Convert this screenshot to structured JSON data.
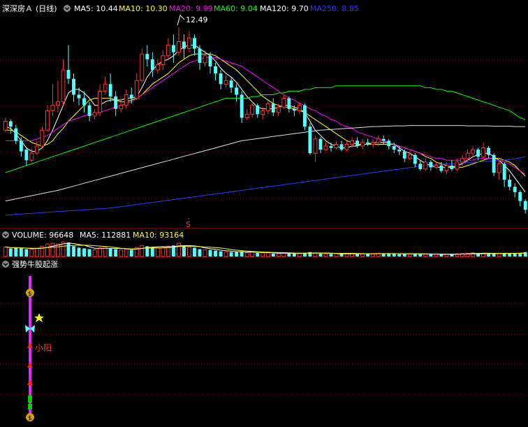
{
  "main_panel": {
    "stock_name": "深深房Ａ",
    "period": "(日线)",
    "ma_values": [
      {
        "label": "MA5: 10.44",
        "color": "#ffffff"
      },
      {
        "label": "MA10: 10.30",
        "color": "#ffff00"
      },
      {
        "label": "MA20: 9.99",
        "color": "#ff00ff"
      },
      {
        "label": "MA60: 9.04",
        "color": "#00ff00"
      },
      {
        "label": "MA120: 9.70",
        "color": "#ffffff"
      },
      {
        "label": "MA250: 8.85",
        "color": "#3333ff"
      }
    ],
    "high_label": "12.49",
    "marker_label": "S"
  },
  "volume_panel": {
    "title": "VOLUME: 96648",
    "ma5": "MA5: 112881",
    "ma10": "MA10: 93164"
  },
  "indicator_panel": {
    "title": "强势牛股起涨",
    "annotation": "小阳"
  },
  "colors": {
    "up": "#ff3232",
    "down": "#54ffff",
    "grid": "#8a0000",
    "separator": "#aa0000"
  },
  "chart_data": {
    "type": "candlestick",
    "y_range": [
      7.0,
      12.8
    ],
    "highest_price": 12.49,
    "candles": [
      [
        9.6,
        9.85,
        9.95,
        9.55
      ],
      [
        9.85,
        9.7,
        9.9,
        9.5
      ],
      [
        9.65,
        9.3,
        9.75,
        9.2
      ],
      [
        9.3,
        9.0,
        9.4,
        8.85
      ],
      [
        9.05,
        8.75,
        9.1,
        8.6
      ],
      [
        8.75,
        8.95,
        9.1,
        8.7
      ],
      [
        8.95,
        9.15,
        9.3,
        8.9
      ],
      [
        9.15,
        9.6,
        9.7,
        9.1
      ],
      [
        9.6,
        10.15,
        10.3,
        9.55
      ],
      [
        10.15,
        10.3,
        10.9,
        10.0
      ],
      [
        10.3,
        10.4,
        11.0,
        10.1
      ],
      [
        10.4,
        11.3,
        11.6,
        10.3
      ],
      [
        11.3,
        11.05,
        12.0,
        10.9
      ],
      [
        11.05,
        10.6,
        11.2,
        10.4
      ],
      [
        10.6,
        10.5,
        10.8,
        10.3
      ],
      [
        10.5,
        10.3,
        10.7,
        10.1
      ],
      [
        10.3,
        10.0,
        10.4,
        9.85
      ],
      [
        10.0,
        10.1,
        10.2,
        9.9
      ],
      [
        10.1,
        10.7,
        10.9,
        10.0
      ],
      [
        10.7,
        10.9,
        11.1,
        10.6
      ],
      [
        10.9,
        10.55,
        11.2,
        10.4
      ],
      [
        10.55,
        10.2,
        10.7,
        10.0
      ],
      [
        10.2,
        10.3,
        10.5,
        10.1
      ],
      [
        10.3,
        10.6,
        10.75,
        10.2
      ],
      [
        10.6,
        10.5,
        10.8,
        10.35
      ],
      [
        10.5,
        11.0,
        11.2,
        10.45
      ],
      [
        11.0,
        11.75,
        11.9,
        10.95
      ],
      [
        11.75,
        11.6,
        12.0,
        11.4
      ],
      [
        11.6,
        11.3,
        11.8,
        11.1
      ],
      [
        11.3,
        11.45,
        11.6,
        11.2
      ],
      [
        11.45,
        11.7,
        11.85,
        11.3
      ],
      [
        11.7,
        12.0,
        12.2,
        11.6
      ],
      [
        12.0,
        11.8,
        12.3,
        11.5
      ],
      [
        11.8,
        12.1,
        12.49,
        11.7
      ],
      [
        12.1,
        11.9,
        12.3,
        11.6
      ],
      [
        11.9,
        12.2,
        12.4,
        11.8
      ],
      [
        12.2,
        11.9,
        12.3,
        11.7
      ],
      [
        11.9,
        11.5,
        12.0,
        11.3
      ],
      [
        11.5,
        11.7,
        11.85,
        11.4
      ],
      [
        11.7,
        11.4,
        11.8,
        11.2
      ],
      [
        11.4,
        11.2,
        11.5,
        11.0
      ],
      [
        11.2,
        10.9,
        11.3,
        10.75
      ],
      [
        10.9,
        11.0,
        11.15,
        10.8
      ],
      [
        11.0,
        10.8,
        11.1,
        10.65
      ],
      [
        10.8,
        10.6,
        10.9,
        10.4
      ],
      [
        10.6,
        9.95,
        10.7,
        9.8
      ],
      [
        9.95,
        10.05,
        10.2,
        9.9
      ],
      [
        10.05,
        10.3,
        10.4,
        9.95
      ],
      [
        10.3,
        10.05,
        10.35,
        9.95
      ],
      [
        10.05,
        10.15,
        10.25,
        9.9
      ],
      [
        10.15,
        10.35,
        10.45,
        10.05
      ],
      [
        10.35,
        10.1,
        10.5,
        10.0
      ],
      [
        10.1,
        10.25,
        10.35,
        10.0
      ],
      [
        10.25,
        10.5,
        10.6,
        10.2
      ],
      [
        10.5,
        10.2,
        10.55,
        10.1
      ],
      [
        10.2,
        10.15,
        10.3,
        10.0
      ],
      [
        10.15,
        10.3,
        10.4,
        10.05
      ],
      [
        10.3,
        9.7,
        10.35,
        9.6
      ],
      [
        9.7,
        8.95,
        9.8,
        8.9
      ],
      [
        8.95,
        9.35,
        9.45,
        8.7
      ],
      [
        9.35,
        9.05,
        9.4,
        8.95
      ],
      [
        9.05,
        9.15,
        9.25,
        9.0
      ],
      [
        9.15,
        9.1,
        9.25,
        9.0
      ],
      [
        9.1,
        9.2,
        9.3,
        9.05
      ],
      [
        9.2,
        9.05,
        9.3,
        9.0
      ],
      [
        9.05,
        9.2,
        9.3,
        9.0
      ],
      [
        9.2,
        9.3,
        9.4,
        9.1
      ],
      [
        9.3,
        9.15,
        9.4,
        9.1
      ],
      [
        9.15,
        9.25,
        9.35,
        9.05
      ],
      [
        9.25,
        9.2,
        9.35,
        9.15
      ],
      [
        9.2,
        9.25,
        9.35,
        9.1
      ],
      [
        9.25,
        9.35,
        9.45,
        9.15
      ],
      [
        9.35,
        9.3,
        9.45,
        9.2
      ],
      [
        9.3,
        9.15,
        9.35,
        9.05
      ],
      [
        9.15,
        9.05,
        9.25,
        8.95
      ],
      [
        9.05,
        9.0,
        9.15,
        8.9
      ],
      [
        9.0,
        8.8,
        9.05,
        8.7
      ],
      [
        8.8,
        8.9,
        9.0,
        8.75
      ],
      [
        8.9,
        8.65,
        8.95,
        8.55
      ],
      [
        8.65,
        8.5,
        8.75,
        8.45
      ],
      [
        8.5,
        8.7,
        8.8,
        8.45
      ],
      [
        8.7,
        8.55,
        8.75,
        8.45
      ],
      [
        8.55,
        8.6,
        8.7,
        8.5
      ],
      [
        8.6,
        8.45,
        8.7,
        8.4
      ],
      [
        8.45,
        8.6,
        8.7,
        8.35
      ],
      [
        8.6,
        8.5,
        8.75,
        8.45
      ],
      [
        8.5,
        8.7,
        8.8,
        8.45
      ],
      [
        8.7,
        8.8,
        8.9,
        8.6
      ],
      [
        8.8,
        8.95,
        9.05,
        8.7
      ],
      [
        8.95,
        9.05,
        9.15,
        8.85
      ],
      [
        9.05,
        8.85,
        9.1,
        8.75
      ],
      [
        8.85,
        9.1,
        9.25,
        8.8
      ],
      [
        9.1,
        8.9,
        9.15,
        8.8
      ],
      [
        8.9,
        8.4,
        8.95,
        8.3
      ],
      [
        8.4,
        8.65,
        8.75,
        8.2
      ],
      [
        8.65,
        8.2,
        8.7,
        8.0
      ],
      [
        8.2,
        8.0,
        8.35,
        7.9
      ],
      [
        8.0,
        7.85,
        8.1,
        7.7
      ],
      [
        7.85,
        7.6,
        7.9,
        7.45
      ],
      [
        7.6,
        7.35,
        7.65,
        7.25
      ]
    ],
    "ma_series": [
      {
        "name": "MA5",
        "color": "#ffffff",
        "values": [
          9.7,
          9.65,
          9.5,
          9.3,
          9.1,
          9.0,
          9.0,
          9.1,
          9.3,
          9.6,
          9.95,
          10.3,
          10.65,
          10.75,
          10.75,
          10.65,
          10.5,
          10.3,
          10.3,
          10.4,
          10.45,
          10.45,
          10.45,
          10.5,
          10.5,
          10.55,
          10.8,
          11.1,
          11.3,
          11.45,
          11.55,
          11.6,
          11.7,
          11.85,
          11.95,
          12.0,
          12.0,
          11.9,
          11.8,
          11.7,
          11.55,
          11.35,
          11.2,
          11.1,
          10.95,
          10.75,
          10.55,
          10.4,
          10.25,
          10.2,
          10.2,
          10.2,
          10.25,
          10.3,
          10.3,
          10.25,
          10.2,
          10.1,
          9.85,
          9.6,
          9.45,
          9.3,
          9.2,
          9.15,
          9.1,
          9.1,
          9.15,
          9.15,
          9.2,
          9.2,
          9.25,
          9.25,
          9.25,
          9.25,
          9.2,
          9.1,
          9.0,
          8.95,
          8.85,
          8.75,
          8.65,
          8.6,
          8.55,
          8.55,
          8.55,
          8.55,
          8.6,
          8.65,
          8.75,
          8.85,
          8.9,
          8.95,
          8.95,
          8.85,
          8.75,
          8.6,
          8.45,
          8.25,
          8.05,
          7.85
        ]
      },
      {
        "name": "MA10",
        "color": "#ffff00",
        "values": [
          9.6,
          9.6,
          9.55,
          9.45,
          9.35,
          9.25,
          9.2,
          9.15,
          9.2,
          9.3,
          9.5,
          9.65,
          9.85,
          10.0,
          10.15,
          10.3,
          10.45,
          10.5,
          10.5,
          10.5,
          10.5,
          10.45,
          10.4,
          10.4,
          10.45,
          10.5,
          10.6,
          10.75,
          10.9,
          11.0,
          11.1,
          11.2,
          11.35,
          11.5,
          11.6,
          11.7,
          11.75,
          11.75,
          11.75,
          11.75,
          11.7,
          11.6,
          11.5,
          11.4,
          11.3,
          11.15,
          11.0,
          10.85,
          10.7,
          10.55,
          10.45,
          10.35,
          10.3,
          10.25,
          10.25,
          10.2,
          10.15,
          10.1,
          10.0,
          9.9,
          9.8,
          9.7,
          9.6,
          9.5,
          9.4,
          9.3,
          9.25,
          9.2,
          9.2,
          9.2,
          9.2,
          9.2,
          9.2,
          9.2,
          9.2,
          9.15,
          9.1,
          9.05,
          9.0,
          8.95,
          8.85,
          8.8,
          8.7,
          8.65,
          8.6,
          8.55,
          8.55,
          8.55,
          8.6,
          8.65,
          8.7,
          8.75,
          8.8,
          8.8,
          8.8,
          8.75,
          8.7,
          8.6,
          8.45,
          8.3
        ]
      },
      {
        "name": "MA20",
        "color": "#ff00ff",
        "values": [
          9.3,
          9.3,
          9.3,
          9.3,
          9.3,
          9.3,
          9.35,
          9.4,
          9.45,
          9.55,
          9.65,
          9.75,
          9.85,
          9.9,
          9.95,
          10.0,
          10.05,
          10.05,
          10.1,
          10.15,
          10.2,
          10.25,
          10.3,
          10.35,
          10.4,
          10.5,
          10.6,
          10.7,
          10.8,
          10.9,
          11.0,
          11.1,
          11.2,
          11.3,
          11.4,
          11.5,
          11.55,
          11.6,
          11.65,
          11.65,
          11.65,
          11.6,
          11.55,
          11.5,
          11.45,
          11.4,
          11.3,
          11.2,
          11.1,
          11.0,
          10.9,
          10.8,
          10.7,
          10.6,
          10.5,
          10.45,
          10.35,
          10.3,
          10.2,
          10.15,
          10.05,
          10.0,
          9.9,
          9.85,
          9.75,
          9.7,
          9.65,
          9.55,
          9.5,
          9.45,
          9.4,
          9.35,
          9.3,
          9.25,
          9.2,
          9.15,
          9.1,
          9.05,
          9.0,
          8.95,
          8.9,
          8.85,
          8.8,
          8.8,
          8.75,
          8.75,
          8.75,
          8.75,
          8.75,
          8.75,
          8.8,
          8.8,
          8.8,
          8.8,
          8.75,
          8.7,
          8.65,
          8.55,
          8.45,
          8.35
        ]
      },
      {
        "name": "MA60",
        "color": "#00ff00",
        "values": [
          8.4,
          8.45,
          8.5,
          8.55,
          8.6,
          8.65,
          8.7,
          8.75,
          8.8,
          8.85,
          8.9,
          8.95,
          9.0,
          9.05,
          9.1,
          9.15,
          9.2,
          9.25,
          9.3,
          9.35,
          9.4,
          9.45,
          9.5,
          9.55,
          9.6,
          9.65,
          9.7,
          9.75,
          9.8,
          9.85,
          9.9,
          9.95,
          10.0,
          10.05,
          10.1,
          10.15,
          10.2,
          10.25,
          10.3,
          10.35,
          10.4,
          10.45,
          10.5,
          10.5,
          10.5,
          10.5,
          10.5,
          10.55,
          10.55,
          10.6,
          10.6,
          10.6,
          10.65,
          10.65,
          10.7,
          10.7,
          10.7,
          10.75,
          10.75,
          10.8,
          10.8,
          10.8,
          10.8,
          10.85,
          10.85,
          10.85,
          10.85,
          10.85,
          10.85,
          10.85,
          10.85,
          10.85,
          10.85,
          10.85,
          10.85,
          10.85,
          10.85,
          10.85,
          10.85,
          10.85,
          10.8,
          10.8,
          10.75,
          10.75,
          10.7,
          10.7,
          10.65,
          10.6,
          10.55,
          10.5,
          10.45,
          10.4,
          10.35,
          10.3,
          10.25,
          10.2,
          10.15,
          10.05,
          9.95,
          9.9
        ]
      },
      {
        "name": "MA120",
        "color": "#e0e0e0",
        "values": [
          7.6,
          7.63,
          7.66,
          7.69,
          7.72,
          7.75,
          7.78,
          7.81,
          7.84,
          7.87,
          7.9,
          7.94,
          7.98,
          8.02,
          8.06,
          8.1,
          8.14,
          8.18,
          8.22,
          8.26,
          8.3,
          8.34,
          8.38,
          8.42,
          8.46,
          8.5,
          8.54,
          8.58,
          8.62,
          8.66,
          8.7,
          8.74,
          8.78,
          8.82,
          8.86,
          8.9,
          8.94,
          8.98,
          9.02,
          9.06,
          9.1,
          9.14,
          9.18,
          9.22,
          9.26,
          9.3,
          9.32,
          9.34,
          9.36,
          9.38,
          9.4,
          9.42,
          9.44,
          9.46,
          9.48,
          9.5,
          9.52,
          9.54,
          9.56,
          9.58,
          9.6,
          9.61,
          9.62,
          9.63,
          9.64,
          9.65,
          9.66,
          9.67,
          9.68,
          9.69,
          9.7,
          9.7,
          9.71,
          9.71,
          9.72,
          9.72,
          9.72,
          9.73,
          9.73,
          9.73,
          9.73,
          9.73,
          9.73,
          9.73,
          9.73,
          9.73,
          9.73,
          9.73,
          9.72,
          9.72,
          9.72,
          9.72,
          9.72,
          9.71,
          9.71,
          9.71,
          9.71,
          9.7,
          9.7,
          9.7
        ]
      },
      {
        "name": "MA250",
        "color": "#3333ff",
        "values": [
          7.2,
          7.21,
          7.22,
          7.23,
          7.24,
          7.25,
          7.26,
          7.27,
          7.28,
          7.29,
          7.3,
          7.31,
          7.32,
          7.33,
          7.34,
          7.35,
          7.36,
          7.37,
          7.38,
          7.39,
          7.4,
          7.42,
          7.44,
          7.46,
          7.48,
          7.5,
          7.52,
          7.54,
          7.56,
          7.58,
          7.6,
          7.62,
          7.64,
          7.66,
          7.68,
          7.7,
          7.72,
          7.74,
          7.76,
          7.78,
          7.8,
          7.82,
          7.84,
          7.86,
          7.88,
          7.9,
          7.92,
          7.94,
          7.96,
          7.98,
          8.0,
          8.02,
          8.04,
          8.06,
          8.08,
          8.1,
          8.12,
          8.14,
          8.16,
          8.18,
          8.2,
          8.22,
          8.24,
          8.26,
          8.28,
          8.3,
          8.32,
          8.34,
          8.36,
          8.38,
          8.4,
          8.42,
          8.44,
          8.46,
          8.48,
          8.5,
          8.52,
          8.54,
          8.56,
          8.58,
          8.6,
          8.61,
          8.62,
          8.63,
          8.64,
          8.65,
          8.66,
          8.67,
          8.68,
          8.69,
          8.7,
          8.71,
          8.72,
          8.73,
          8.74,
          8.75,
          8.77,
          8.79,
          8.82,
          8.85
        ]
      }
    ],
    "volume": [
      0.65,
      0.55,
      0.6,
      0.55,
      0.5,
      0.5,
      0.55,
      0.7,
      0.85,
      0.9,
      0.85,
      1.0,
      0.95,
      0.7,
      0.6,
      0.55,
      0.5,
      0.45,
      0.6,
      0.65,
      0.55,
      0.5,
      0.45,
      0.5,
      0.45,
      0.6,
      0.75,
      0.7,
      0.65,
      0.6,
      0.65,
      0.7,
      0.75,
      0.9,
      0.7,
      0.65,
      0.6,
      0.5,
      0.45,
      0.45,
      0.4,
      0.35,
      0.3,
      0.3,
      0.3,
      0.35,
      0.25,
      0.3,
      0.25,
      0.25,
      0.25,
      0.2,
      0.2,
      0.25,
      0.2,
      0.2,
      0.2,
      0.25,
      0.3,
      0.25,
      0.2,
      0.18,
      0.18,
      0.2,
      0.18,
      0.18,
      0.2,
      0.18,
      0.18,
      0.18,
      0.2,
      0.22,
      0.2,
      0.18,
      0.18,
      0.15,
      0.18,
      0.18,
      0.2,
      0.15,
      0.15,
      0.15,
      0.15,
      0.15,
      0.15,
      0.15,
      0.18,
      0.2,
      0.22,
      0.25,
      0.2,
      0.22,
      0.2,
      0.2,
      0.2,
      0.22,
      0.2,
      0.22,
      0.25,
      0.3
    ]
  }
}
